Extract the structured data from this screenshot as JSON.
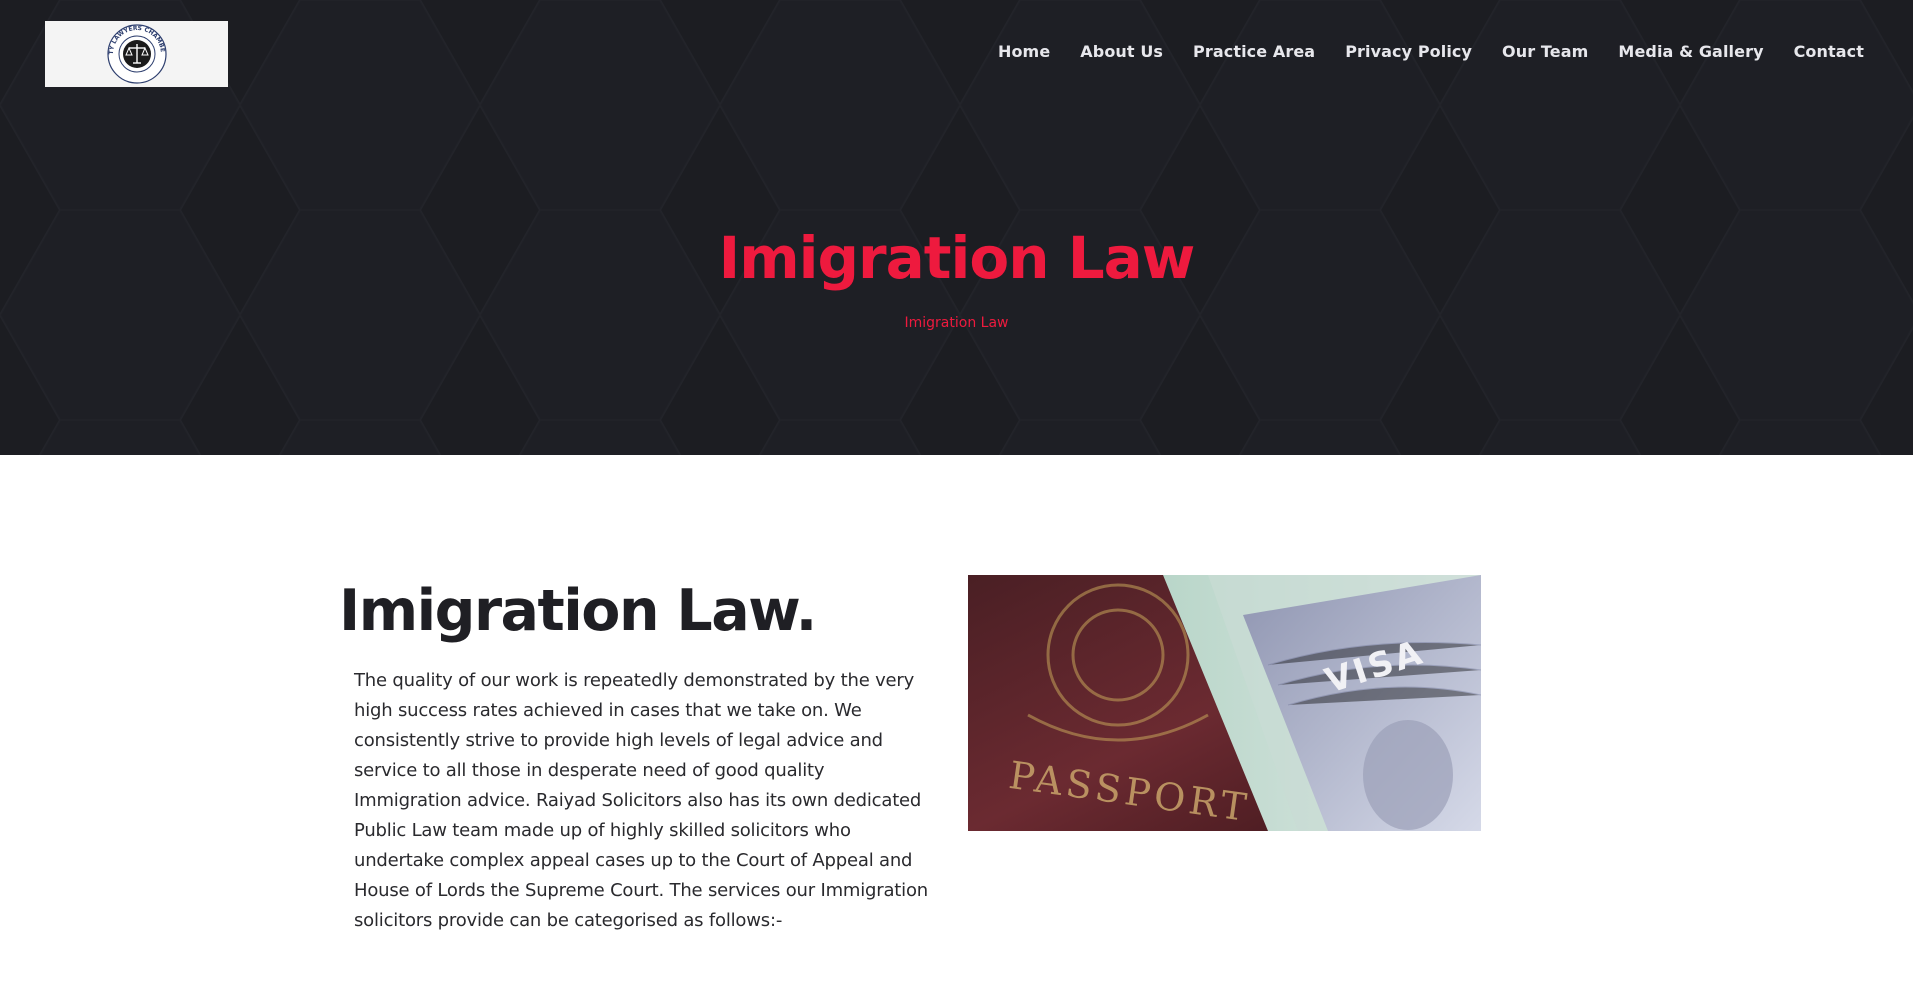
{
  "header": {
    "logo_alt": "City Lawyers Chambers",
    "logo_text": "CITY LAWYERS CHAMBERS",
    "nav": [
      {
        "label": "Home"
      },
      {
        "label": "About Us"
      },
      {
        "label": "Practice Area"
      },
      {
        "label": "Privacy Policy"
      },
      {
        "label": "Our Team"
      },
      {
        "label": "Media & Gallery"
      },
      {
        "label": "Contact"
      }
    ]
  },
  "hero": {
    "title": "Imigration Law",
    "breadcrumb": "Imigration Law"
  },
  "content": {
    "heading": "Imigration Law.",
    "paragraph": "The quality of our work is repeatedly demonstrated by the very high success rates achieved in cases that we take on. We consistently strive to provide high levels of legal advice and service to all those in desperate need of good quality Immigration advice. Raiyad Solicitors also has its own dedicated Public Law team made up of highly skilled solicitors who undertake complex appeal cases up to the Court of Appeal and House of Lords the Supreme Court. The services our Immigration solicitors provide can be categorised as follows:-",
    "image": {
      "passport_text": "PASSPORT",
      "visa_text": "VISA"
    }
  },
  "colors": {
    "accent": "#ee1a3e",
    "hero_bg": "#1c1d22",
    "nav_text": "#e7e7ec",
    "heading": "#1f1f24"
  }
}
